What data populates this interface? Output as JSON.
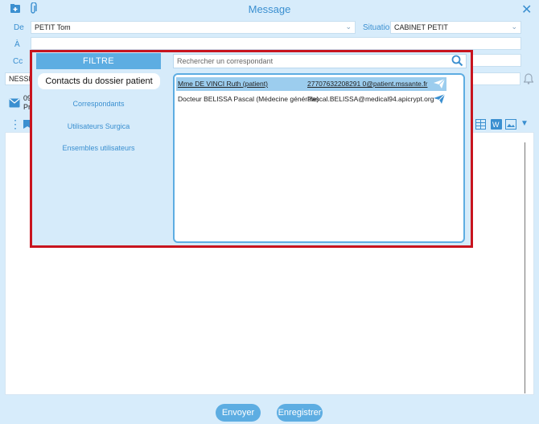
{
  "window": {
    "title": "Message"
  },
  "labels": {
    "de": "De",
    "a": "À",
    "cc": "Cc",
    "situation": "Situation"
  },
  "fields": {
    "de_value": "PETIT Tom",
    "situation_value": "CABINET PETIT",
    "subject_partial": "NESSI R"
  },
  "attachment": {
    "line1": "09",
    "line2": "Pr"
  },
  "popup": {
    "filter_title": "FILTRE",
    "filters": [
      "Contacts du dossier patient",
      "Correspondants",
      "Utilisateurs Surgica",
      "Ensembles utilisateurs"
    ],
    "search_placeholder": "Rechercher un correspondant",
    "contacts": [
      {
        "name": "Mme DE VINCI Ruth (patient)",
        "email": "27707632208291 0@patient.mssante.fr"
      },
      {
        "name": "Docteur BELISSA Pascal (Médecine générale)",
        "email": "Pascal.BELISSA@medical94.apicrypt.org"
      }
    ]
  },
  "buttons": {
    "send": "Envoyer",
    "save": "Enregistrer"
  },
  "colors": {
    "accent": "#5dade2",
    "highlight_border": "#c8141e",
    "background": "#d7ecfb"
  }
}
